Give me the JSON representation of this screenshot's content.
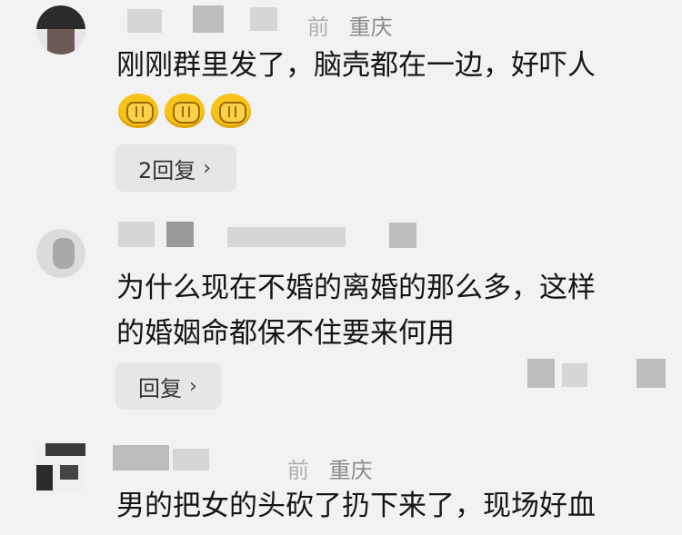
{
  "comments": [
    {
      "location": "重庆",
      "meta_prefix": "前",
      "lines": [
        "刚刚群里发了，脑壳都在一边，好吓人"
      ],
      "emoji_count": 3,
      "emoji_icon": "covering-face-emoji",
      "reply_label": "2回复",
      "reply_chevron": "›"
    },
    {
      "location": "",
      "meta_prefix": "",
      "lines": [
        "为什么现在不婚的离婚的那么多，这样",
        "的婚姻命都保不住要来何用"
      ],
      "reply_label": "回复",
      "reply_chevron": "›"
    },
    {
      "location": "重庆",
      "meta_prefix": "前",
      "lines": [
        "男的把女的头砍了扔下来了，现场好血"
      ]
    }
  ]
}
